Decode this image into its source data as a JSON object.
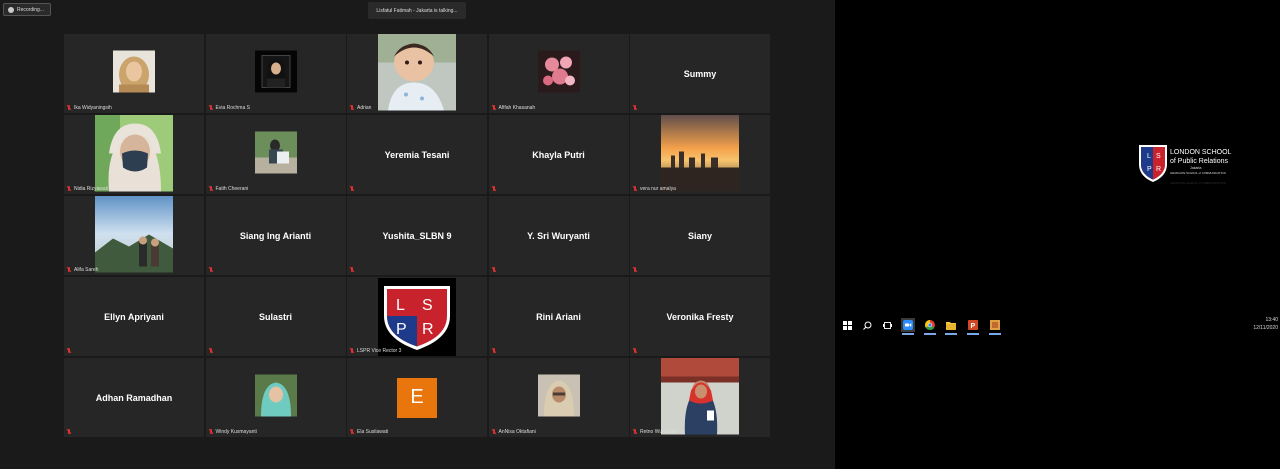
{
  "recording": {
    "label": "Recording..."
  },
  "speaker_banner": "Lisfatul Fatimah - Jakarta is talking...",
  "participants": [
    {
      "name": "Ika Widyaningsih",
      "type": "photo",
      "photo": "woman-hijab-beige"
    },
    {
      "name": "Evia Rochma S",
      "type": "photo",
      "photo": "woman-black-frame"
    },
    {
      "name": "Adrian",
      "type": "photo",
      "photo": "baby"
    },
    {
      "name": "Afifah Khasanah",
      "type": "photo",
      "photo": "pink-flowers"
    },
    {
      "name": "Summy",
      "type": "name"
    },
    {
      "name": "Nidia Rizyawati",
      "type": "photo",
      "photo": "woman-mask"
    },
    {
      "name": "Fatih Cheerani",
      "type": "photo",
      "photo": "person-outdoor"
    },
    {
      "name": "Yeremia Tesani",
      "type": "name"
    },
    {
      "name": "Khayla Putri",
      "type": "name"
    },
    {
      "name": "vera nur amalya",
      "type": "photo",
      "photo": "sunset-city"
    },
    {
      "name": "Alifa Sareh",
      "type": "photo",
      "photo": "mountain-couple"
    },
    {
      "name": "Siang Ing Arianti",
      "type": "name"
    },
    {
      "name": "Yushita_SLBN 9",
      "type": "name"
    },
    {
      "name": "Y. Sri Wuryanti",
      "type": "name"
    },
    {
      "name": "Siany",
      "type": "name"
    },
    {
      "name": "Ellyn Apriyani",
      "type": "name"
    },
    {
      "name": "Sulastri",
      "type": "name"
    },
    {
      "name": "LSPR Vice Rector 3",
      "type": "logo"
    },
    {
      "name": "Rini Ariani",
      "type": "name"
    },
    {
      "name": "Veronika Fresty",
      "type": "name"
    },
    {
      "name": "Adhan Ramadhan",
      "type": "name"
    },
    {
      "name": "Windy Kusmayanti",
      "type": "photo",
      "photo": "woman-hijab-teal"
    },
    {
      "name": "Ela Susilawati",
      "type": "initial",
      "initial": "E"
    },
    {
      "name": "AnNisa Oktafiani",
      "type": "photo",
      "photo": "woman-hijab-cream"
    },
    {
      "name": "Retno Wulandari",
      "type": "photo",
      "photo": "woman-red-hijab"
    }
  ],
  "logo": {
    "letters": [
      "L",
      "S",
      "P",
      "R"
    ],
    "line1": "LONDON SCHOOL",
    "line2": "of Public Relations",
    "line3": "Jakarta",
    "line4": "GRADUATE SCHOOL of COMMUNICATION",
    "reflection": "GRADUATE SCHOOL of COMMUNICATION"
  },
  "taskbar": {
    "icons": [
      "windows-icon",
      "search-icon",
      "task-view-icon",
      "zoom-icon",
      "chrome-icon",
      "file-explorer-icon",
      "powerpoint-icon",
      "photos-icon"
    ],
    "time": "13:40",
    "date": "12/11/2020"
  },
  "colors": {
    "accent": "#e8760c",
    "muted_mic": "#e03030",
    "brand_red": "#c8232c",
    "brand_blue": "#1e3a8a"
  }
}
